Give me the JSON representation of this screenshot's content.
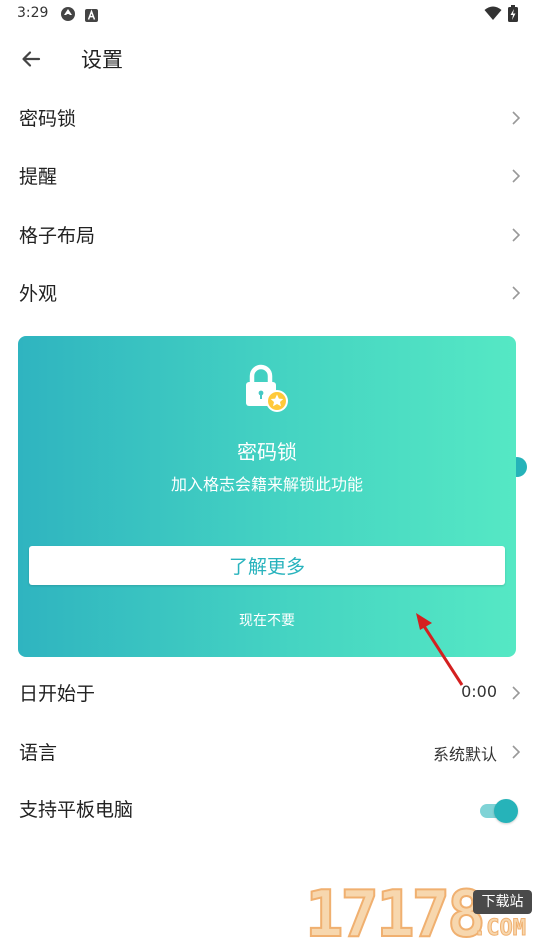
{
  "status_bar": {
    "time": "3:29",
    "icons": [
      "sync-icon",
      "a-badge-icon",
      "wifi-icon",
      "battery-charging-icon"
    ]
  },
  "app_bar": {
    "title": "设置",
    "back_icon": "back-arrow-icon"
  },
  "settings": {
    "items": [
      {
        "label": "密码锁"
      },
      {
        "label": "提醒"
      },
      {
        "label": "格子布局"
      },
      {
        "label": "外观"
      }
    ],
    "week_start": {
      "label": "日开始于",
      "value": "0:00"
    },
    "language": {
      "label": "语言",
      "value": "系统默认"
    },
    "tablet": {
      "label": "支持平板电脑",
      "enabled": true
    }
  },
  "promo_dialog": {
    "icon": "lock-star-icon",
    "title": "密码锁",
    "subtitle": "加入格志会籍来解锁此功能",
    "primary_button": "了解更多",
    "secondary_link": "现在不要",
    "gradient": [
      "#2fb4c0",
      "#55e8c4"
    ]
  },
  "watermark": {
    "number": "17178",
    "badge": "下载站",
    "domain": ".COM"
  },
  "colors": {
    "accent": "#26b3b9",
    "button_text": "#28b3bd",
    "annotation_arrow": "#d42020"
  }
}
